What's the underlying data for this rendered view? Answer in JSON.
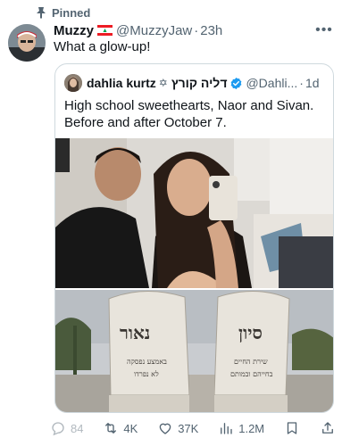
{
  "pinned_label": "Pinned",
  "post": {
    "author_name": "Muzzy",
    "author_handle": "@MuzzyJaw",
    "time": "23h",
    "text": "What a glow-up!"
  },
  "quoted": {
    "author_name": "dahlia kurtz",
    "author_name_hebrew": "דליה קורץ",
    "author_handle": "@Dahli...",
    "time": "1d",
    "text": "High school sweethearts, Naor and Sivan. Before and after October 7.",
    "stone_left_name": "נאור",
    "stone_left_line1": "באמצע נפסקה",
    "stone_left_line2": "לא נפרדו",
    "stone_right_name": "סיון",
    "stone_right_line1": "שירת החיים",
    "stone_right_line2": "בחייהם ובמותם"
  },
  "actions": {
    "replies": "84",
    "reposts": "4K",
    "likes": "37K",
    "views": "1.2M"
  },
  "colors": {
    "text": "#0f1419",
    "secondary": "#536471",
    "border": "#cfd9de",
    "verified": "#1d9bf0"
  }
}
